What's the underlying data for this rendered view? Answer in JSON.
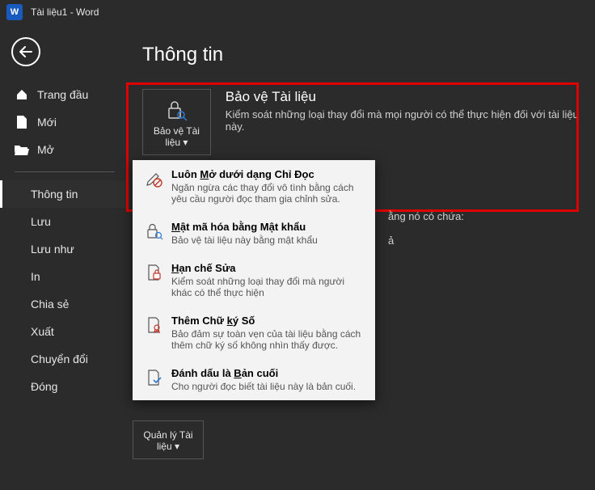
{
  "titlebar": {
    "word_label": "W",
    "title": "Tài liệu1  -  Word"
  },
  "sidebar": {
    "top": [
      {
        "label": "Trang đầu"
      },
      {
        "label": "Mới"
      },
      {
        "label": "Mở"
      }
    ],
    "sub": [
      {
        "label": "Thông tin",
        "active": true
      },
      {
        "label": "Lưu"
      },
      {
        "label": "Lưu như"
      },
      {
        "label": "In"
      },
      {
        "label": "Chia sẻ"
      },
      {
        "label": "Xuất"
      },
      {
        "label": "Chuyển đổi"
      },
      {
        "label": "Đóng"
      }
    ]
  },
  "main": {
    "heading": "Thông tin",
    "protect_btn": "Bảo vệ Tài liệu",
    "protect_title": "Bảo vệ Tài liệu",
    "protect_desc": "Kiểm soát những loại thay đổi mà mọi người có thể thực hiện đối với tài liệu này.",
    "inspect_fragment1": "ằng nó có chứa:",
    "inspect_fragment2": "ả",
    "manage_btn": "Quản lý Tài liệu"
  },
  "menu": [
    {
      "title_pre": "Luôn ",
      "title_ul": "M",
      "title_post": "ở dưới dạng Chỉ Đọc",
      "desc": "Ngăn ngừa các thay đổi vô tình bằng cách yêu cầu người đọc tham gia chỉnh sửa."
    },
    {
      "title_pre": "",
      "title_ul": "M",
      "title_post": "ật mã hóa bằng Mật khẩu",
      "desc": "Bảo vệ tài liệu này bằng mật khẩu"
    },
    {
      "title_pre": "",
      "title_ul": "H",
      "title_post": "ạn chế Sửa",
      "desc": "Kiểm soát những loại thay đổi mà người khác có thể thực hiện"
    },
    {
      "title_pre": "Thêm Chữ ",
      "title_ul": "k",
      "title_post": "ý Số",
      "desc": "Bảo đảm sự toàn vẹn của tài liệu bằng cách thêm chữ ký số không nhìn thấy được."
    },
    {
      "title_pre": "Đánh dấu là ",
      "title_ul": "B",
      "title_post": "ản cuối",
      "desc": "Cho người đọc biết tài liệu này là bản cuối."
    }
  ]
}
